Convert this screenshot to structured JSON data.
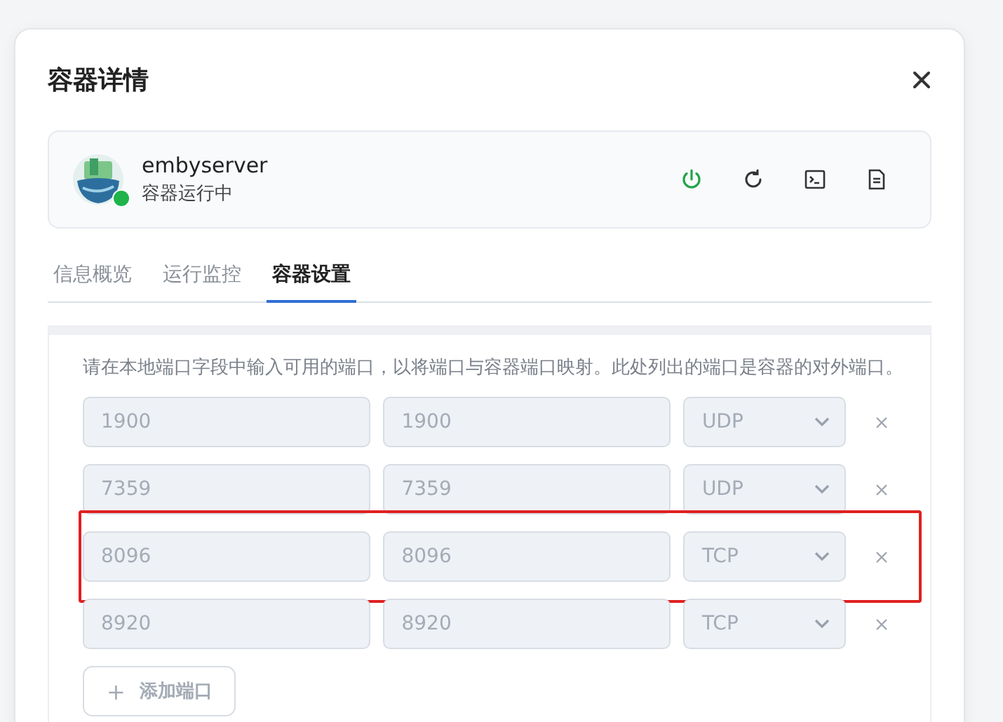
{
  "dialog": {
    "title": "容器详情"
  },
  "container": {
    "name": "embyserver",
    "status": "容器运行中",
    "running": true
  },
  "tabs": [
    {
      "label": "信息概览",
      "selected": false
    },
    {
      "label": "运行监控",
      "selected": false
    },
    {
      "label": "容器设置",
      "selected": true
    }
  ],
  "ports": {
    "hint": "请在本地端口字段中输入可用的端口，以将端口与容器端口映射。此处列出的端口是容器的对外端口。",
    "rows": [
      {
        "local": "1900",
        "container": "1900",
        "protocol": "UDP",
        "disabled": true,
        "highlighted": false
      },
      {
        "local": "7359",
        "container": "7359",
        "protocol": "UDP",
        "disabled": true,
        "highlighted": false
      },
      {
        "local": "8096",
        "container": "8096",
        "protocol": "TCP",
        "disabled": true,
        "highlighted": true
      },
      {
        "local": "8920",
        "container": "8920",
        "protocol": "TCP",
        "disabled": true,
        "highlighted": false
      }
    ],
    "add_button": {
      "icon": "+",
      "label": "添加端口"
    }
  }
}
